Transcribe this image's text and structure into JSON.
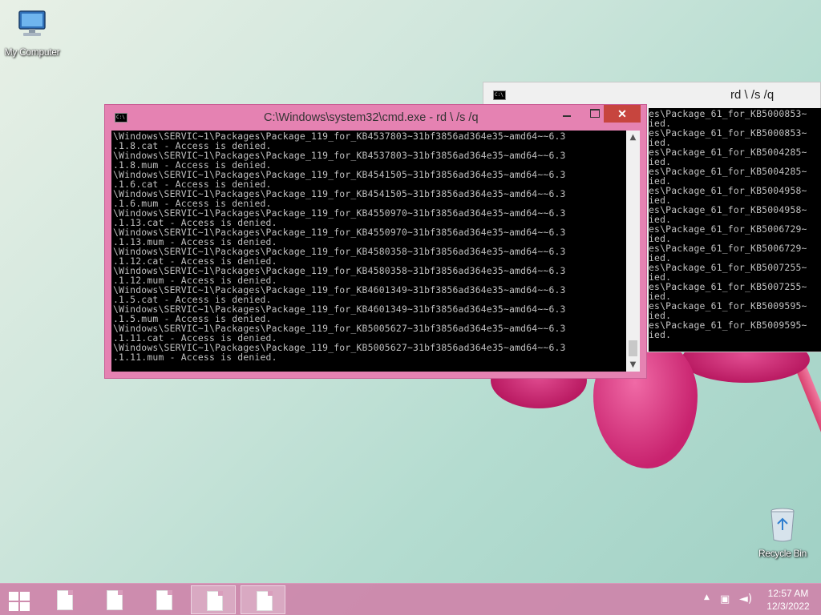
{
  "desktop": {
    "icons": [
      {
        "label": "My Computer",
        "icon": "computer-icon"
      },
      {
        "label": "Recycle Bin",
        "icon": "recycle-bin-icon"
      }
    ]
  },
  "front_window": {
    "title": "C:\\Windows\\system32\\cmd.exe - rd \\ /s /q",
    "lines": [
      "\\Windows\\SERVIC~1\\Packages\\Package_119_for_KB4537803~31bf3856ad364e35~amd64~~6.3",
      ".1.8.cat - Access is denied.",
      "\\Windows\\SERVIC~1\\Packages\\Package_119_for_KB4537803~31bf3856ad364e35~amd64~~6.3",
      ".1.8.mum - Access is denied.",
      "\\Windows\\SERVIC~1\\Packages\\Package_119_for_KB4541505~31bf3856ad364e35~amd64~~6.3",
      ".1.6.cat - Access is denied.",
      "\\Windows\\SERVIC~1\\Packages\\Package_119_for_KB4541505~31bf3856ad364e35~amd64~~6.3",
      ".1.6.mum - Access is denied.",
      "\\Windows\\SERVIC~1\\Packages\\Package_119_for_KB4550970~31bf3856ad364e35~amd64~~6.3",
      ".1.13.cat - Access is denied.",
      "\\Windows\\SERVIC~1\\Packages\\Package_119_for_KB4550970~31bf3856ad364e35~amd64~~6.3",
      ".1.13.mum - Access is denied.",
      "\\Windows\\SERVIC~1\\Packages\\Package_119_for_KB4580358~31bf3856ad364e35~amd64~~6.3",
      ".1.12.cat - Access is denied.",
      "\\Windows\\SERVIC~1\\Packages\\Package_119_for_KB4580358~31bf3856ad364e35~amd64~~6.3",
      ".1.12.mum - Access is denied.",
      "\\Windows\\SERVIC~1\\Packages\\Package_119_for_KB4601349~31bf3856ad364e35~amd64~~6.3",
      ".1.5.cat - Access is denied.",
      "\\Windows\\SERVIC~1\\Packages\\Package_119_for_KB4601349~31bf3856ad364e35~amd64~~6.3",
      ".1.5.mum - Access is denied.",
      "\\Windows\\SERVIC~1\\Packages\\Package_119_for_KB5005627~31bf3856ad364e35~amd64~~6.3",
      ".1.11.cat - Access is denied.",
      "\\Windows\\SERVIC~1\\Packages\\Package_119_for_KB5005627~31bf3856ad364e35~amd64~~6.3",
      ".1.11.mum - Access is denied."
    ],
    "close_label": "✕"
  },
  "back_window": {
    "title": "rd \\ /s /q",
    "lines": [
      "es\\Package_61_for_KB5000853~",
      "ied.",
      "es\\Package_61_for_KB5000853~",
      "ied.",
      "es\\Package_61_for_KB5004285~",
      "ied.",
      "es\\Package_61_for_KB5004285~",
      "ied.",
      "es\\Package_61_for_KB5004958~",
      "ied.",
      "es\\Package_61_for_KB5004958~",
      "ied.",
      "es\\Package_61_for_KB5006729~",
      "ied.",
      "es\\Package_61_for_KB5006729~",
      "ied.",
      "es\\Package_61_for_KB5007255~",
      "ied.",
      "es\\Package_61_for_KB5007255~",
      "ied.",
      "es\\Package_61_for_KB5009595~",
      "ied.",
      "es\\Package_61_for_KB5009595~",
      "ied."
    ]
  },
  "taskbar": {
    "items": [
      {
        "icon": "document-icon",
        "active": false
      },
      {
        "icon": "document-icon",
        "active": false
      },
      {
        "icon": "document-icon",
        "active": false
      },
      {
        "icon": "document-icon",
        "active": true
      },
      {
        "icon": "document-icon",
        "active": true
      }
    ],
    "time": "12:57 AM",
    "date": "12/3/2022"
  },
  "colors": {
    "window_frame": "#e582b2",
    "close_button": "#c7453e",
    "console_bg": "#000000",
    "console_text": "#c0c0c0",
    "taskbar": "#ce84aa"
  }
}
